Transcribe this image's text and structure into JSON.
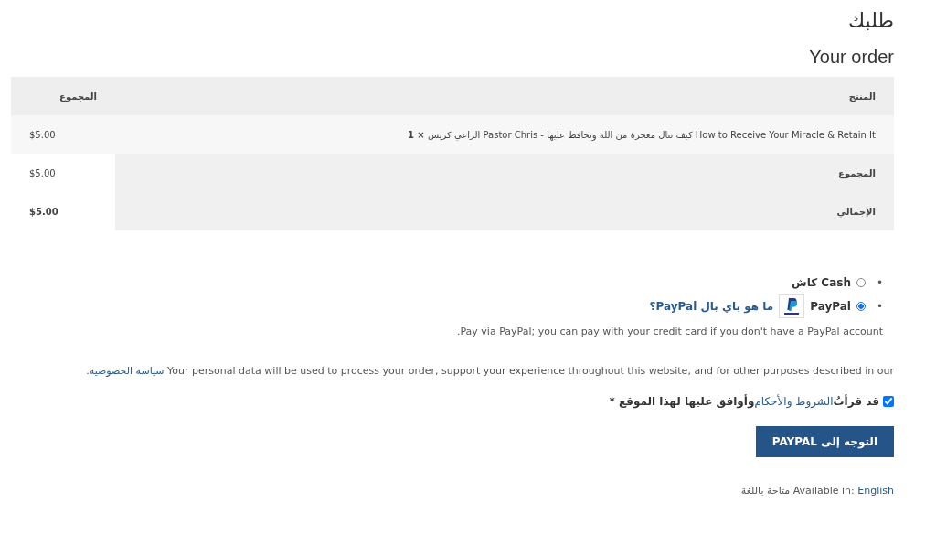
{
  "heading": "طلبك",
  "subheading": "Your order",
  "table": {
    "columns": [
      "المنتج",
      "المجموع"
    ],
    "item": {
      "name": "How to Receive Your Miracle & Retain It كيف تنال معجزة من الله وتحافظ عليها - Pastor Chris الراعي كريس",
      "quantity": "× 1",
      "total": "$5.00"
    },
    "summary": [
      {
        "label": "المجموع",
        "value": "$5.00",
        "bold": false
      },
      {
        "label": "الإجمالي",
        "value": "$5.00",
        "bold": true
      }
    ]
  },
  "payment_methods": [
    {
      "bullet": "•",
      "label": "Cash كاش",
      "selected": false
    },
    {
      "bullet": "•",
      "label": "PayPal",
      "selected": true,
      "info_link": "ما هو باي بال PayPal؟",
      "description": "Pay via PayPal; you can pay with your credit card if you don't have a PayPal account."
    }
  ],
  "privacy": {
    "text": "Your personal data will be used to process your order, support your experience throughout this website, and for other purposes described in our ",
    "link": "سياسة الخصوصية",
    "end": "."
  },
  "terms": {
    "checked": true,
    "before": "قد قرأتُ ",
    "link": "الشروط والأحكام",
    "after": " وأوافق عليها لهذا الموقع",
    "required": "*"
  },
  "button": "التوجه إلى PAYPAL",
  "language": {
    "before": "Available in: ",
    "link": "English",
    "after": " متاحة باللغة"
  }
}
